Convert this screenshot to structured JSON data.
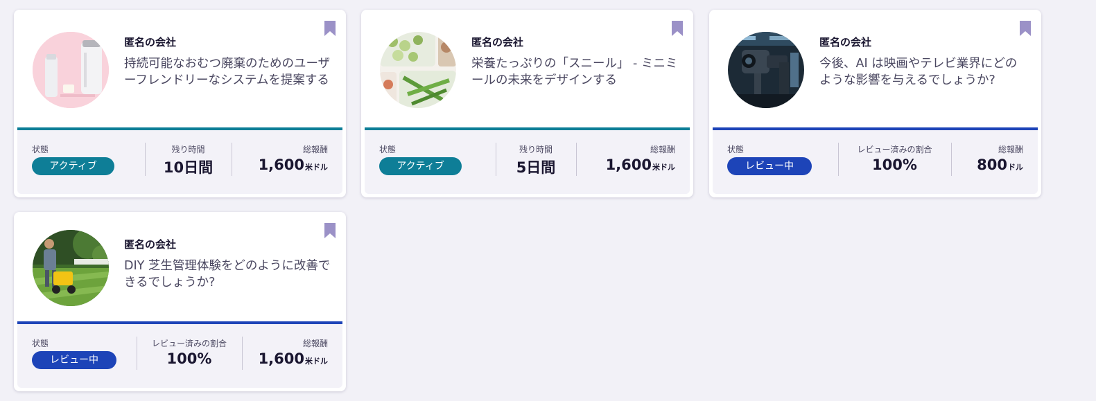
{
  "colors": {
    "active": "#0e7e97",
    "review": "#1d44b8",
    "bookmark": "#9b91c7",
    "page_background": "#f2f1f7"
  },
  "cards": [
    {
      "company": "匿名の会社",
      "title": "持続可能なおむつ廃棄のためのユーザーフレンドリーなシステムを提案する",
      "status_label": "状態",
      "status": "アクティブ",
      "middle_label": "残り時間",
      "middle_value": "10日間",
      "reward_label": "総報酬",
      "reward_amount": "1,600",
      "reward_unit": "米ドル",
      "image": "diaper-pail-photo",
      "bookmark_icon": "bookmark-icon"
    },
    {
      "company": "匿名の会社",
      "title": "栄養たっぷりの「スニール」 - ミニミールの未来をデザインする",
      "status_label": "状態",
      "status": "アクティブ",
      "middle_label": "残り時間",
      "middle_value": "5日間",
      "reward_label": "総報酬",
      "reward_amount": "1,600",
      "reward_unit": "米ドル",
      "image": "meal-prep-photo",
      "bookmark_icon": "bookmark-icon"
    },
    {
      "company": "匿名の会社",
      "title": "今後、AI は映画やテレビ業界にどのような影響を与えるでしょうか?",
      "status_label": "状態",
      "status": "レビュー中",
      "middle_label": "レビュー済みの割合",
      "middle_value": "100%",
      "reward_label": "総報酬",
      "reward_amount": "800",
      "reward_unit": "ドル",
      "image": "film-camera-photo",
      "bookmark_icon": "bookmark-icon"
    },
    {
      "company": "匿名の会社",
      "title": "DIY 芝生管理体験をどのように改善できるでしょうか?",
      "status_label": "状態",
      "status": "レビュー中",
      "middle_label": "レビュー済みの割合",
      "middle_value": "100%",
      "reward_label": "総報酬",
      "reward_amount": "1,600",
      "reward_unit": "米ドル",
      "image": "lawn-spreader-photo",
      "bookmark_icon": "bookmark-icon"
    }
  ]
}
